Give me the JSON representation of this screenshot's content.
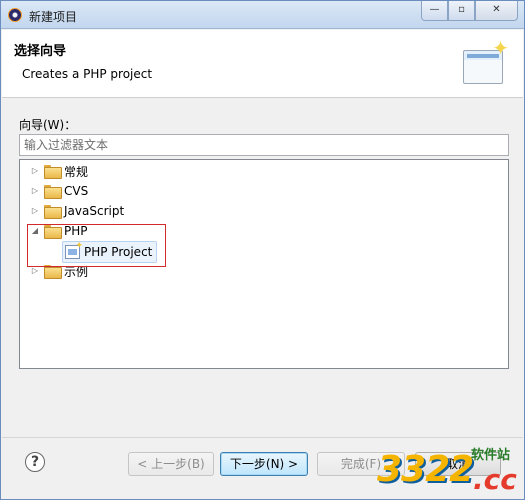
{
  "window": {
    "title": "新建项目",
    "controls": {
      "minimize": "—",
      "maximize": "▫",
      "close": "✕"
    }
  },
  "banner": {
    "title": "选择向导",
    "description": "Creates a PHP project",
    "image_icon": "wizard-banner-icon"
  },
  "wizard_label": "向导(W)：",
  "filter": {
    "placeholder": "输入过滤器文本",
    "value": ""
  },
  "tree": {
    "items": [
      {
        "label": "常规",
        "expanded": false,
        "icon": "folder-icon"
      },
      {
        "label": "CVS",
        "expanded": false,
        "icon": "folder-icon"
      },
      {
        "label": "JavaScript",
        "expanded": false,
        "icon": "folder-icon"
      },
      {
        "label": "PHP",
        "expanded": true,
        "icon": "folder-icon",
        "children": [
          {
            "label": "PHP Project",
            "icon": "php-project-icon",
            "selected": true
          }
        ]
      },
      {
        "label": "示例",
        "expanded": false,
        "icon": "folder-icon"
      }
    ],
    "expander_collapsed": "▷",
    "expander_expanded": "◢"
  },
  "footer": {
    "help": "?",
    "back": "< 上一步(B)",
    "next": "下一步(N) >",
    "finish": "完成(F)",
    "cancel": "取消"
  },
  "watermark": {
    "number": "3322",
    "domain": ".cc",
    "text": "软件站"
  },
  "colors": {
    "highlight_box": "#d02a2a",
    "selection": "#eaf3fc",
    "primary_button": "#bee6fd"
  }
}
